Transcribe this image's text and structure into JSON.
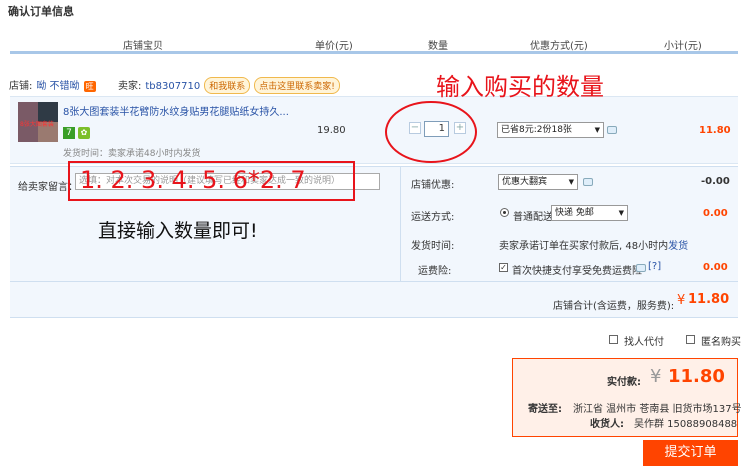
{
  "page": {
    "title": "确认订单信息"
  },
  "columns": [
    "店铺宝贝",
    "单价(元)",
    "数量",
    "优惠方式(元)",
    "小计(元)"
  ],
  "shop": {
    "label": "店铺:",
    "name": "呦 不错呦",
    "badge": "旺",
    "seller_label": "卖家:",
    "seller": "tb8307710",
    "contact_label": "和我联系",
    "contact_hint": "点击这里联系卖家!"
  },
  "item": {
    "thumb_text": "8张大图套装",
    "title": "8张大图套装半花臂防水纹身贴男花腿贴纸女持久...",
    "icon_7": "7",
    "shipping_time": "发货时间：卖家承诺48小时内发货",
    "price": "19.80",
    "quantity": "1",
    "qty_minus": "−",
    "qty_plus": "+",
    "discount_select": "已省8元:2份18张",
    "subtotal": "11.80"
  },
  "message": {
    "label": "给卖家留言：",
    "placeholder": "选填：对本次交易的说明（建议填写已经和卖家达成一致的说明）"
  },
  "order_info": {
    "shop_discount_label": "店铺优惠:",
    "shop_discount_select": "优惠大翻宾",
    "shop_discount_value": "-0.00",
    "shipping_label": "运送方式:",
    "shipping_option": "普通配送",
    "shipping_select": "快递 免邮",
    "shipping_value": "0.00",
    "delivery_label": "发货时间:",
    "delivery_text": "卖家承诺订单在买家付款后, 48小时内",
    "delivery_link": "发货",
    "insurance_label": "运费险:",
    "insurance_text": "首次快捷支付享受免费运费险",
    "insurance_help": "[?]",
    "insurance_value": "0.00"
  },
  "shop_total": {
    "label": "店铺合计(含运费，服务费):",
    "currency": "¥",
    "value": "11.80"
  },
  "options": {
    "proxy_pay": "找人代付",
    "anonymous": "匿名购买"
  },
  "payment": {
    "label": "实付款:",
    "currency": "¥",
    "amount": "11.80",
    "ship_to_label": "寄送至:",
    "address": "浙江省 温州市 苍南县 旧货市场137号",
    "receiver_label": "收货人:",
    "receiver": "吴作群 15088908488"
  },
  "submit_label": "提交订单",
  "annotations": {
    "quantity_note": "输入购买的数量",
    "sequence": "1. 2. 3. 4. 5. 6*2. 7",
    "direct_input_note": "直接输入数量即可!"
  },
  "colors": {
    "accent": "#ff4400",
    "annotation": "#e8141b",
    "link": "#2953a6"
  }
}
